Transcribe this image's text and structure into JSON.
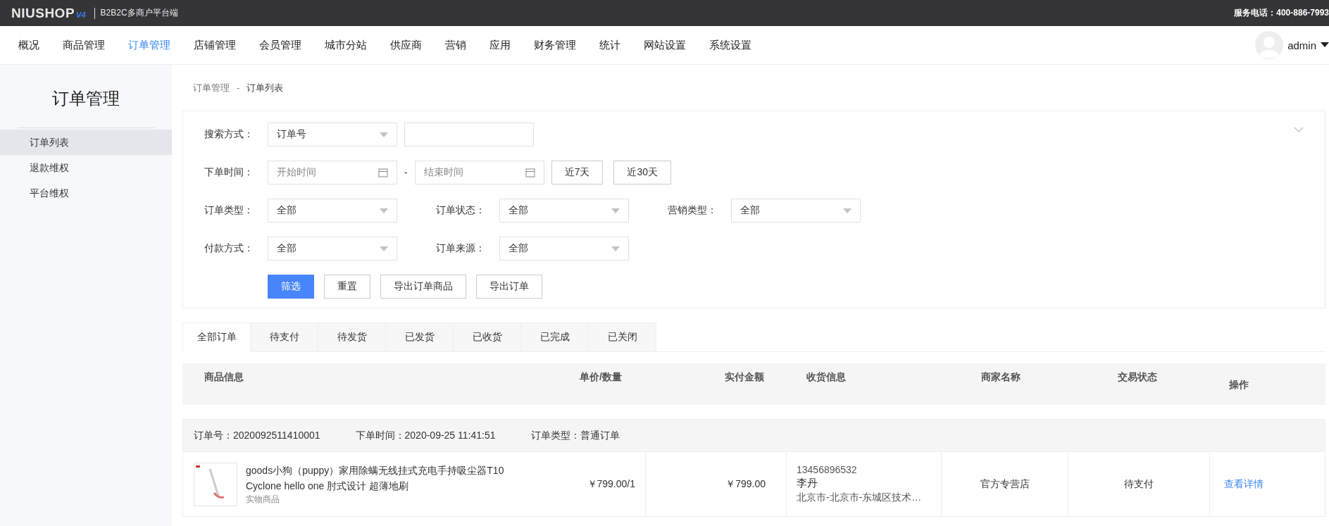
{
  "top_bar": {
    "logo": "NIUSHOP",
    "logo_version": "V4",
    "platform": "B2B2C多商户平台端",
    "hotline": "服务电话：400-886-7993"
  },
  "nav": {
    "items": [
      {
        "label": "概况",
        "selected": false
      },
      {
        "label": "商品管理",
        "selected": false
      },
      {
        "label": "订单管理",
        "selected": true
      },
      {
        "label": "店铺管理",
        "selected": false
      },
      {
        "label": "会员管理",
        "selected": false
      },
      {
        "label": "城市分站",
        "selected": false
      },
      {
        "label": "供应商",
        "selected": false
      },
      {
        "label": "营销",
        "selected": false
      },
      {
        "label": "应用",
        "selected": false
      },
      {
        "label": "财务管理",
        "selected": false
      },
      {
        "label": "统计",
        "selected": false
      },
      {
        "label": "网站设置",
        "selected": false
      },
      {
        "label": "系统设置",
        "selected": false
      }
    ],
    "user": "admin"
  },
  "sidebar": {
    "title": "订单管理",
    "items": [
      {
        "label": "订单列表",
        "selected": true
      },
      {
        "label": "退款维权",
        "selected": false
      },
      {
        "label": "平台维权",
        "selected": false
      }
    ]
  },
  "breadcrumb": [
    "订单管理",
    "-",
    "订单列表"
  ],
  "filters": {
    "search_label": "搜索方式：",
    "search_type": "订单号",
    "time_label": "下单时间：",
    "start_placeholder": "开始时间",
    "separator": "-",
    "end_placeholder": "结束时间",
    "quick_ranges": [
      "近7天",
      "近30天"
    ],
    "selects": [
      [
        {
          "label": "订单类型：",
          "value": "全部"
        },
        {
          "label": "订单状态：",
          "value": "全部"
        },
        {
          "label": "营销类型：",
          "value": "全部"
        }
      ],
      [
        {
          "label": "付款方式：",
          "value": "全部"
        },
        {
          "label": "订单来源：",
          "value": "全部"
        }
      ]
    ],
    "buttons": [
      {
        "label": "筛选",
        "kind": "primary"
      },
      {
        "label": "重置",
        "kind": "default"
      },
      {
        "label": "导出订单商品",
        "kind": "default"
      },
      {
        "label": "导出订单",
        "kind": "default"
      }
    ]
  },
  "tabs": [
    {
      "label": "全部订单",
      "selected": true
    },
    {
      "label": "待支付",
      "selected": false
    },
    {
      "label": "待发货",
      "selected": false
    },
    {
      "label": "已发货",
      "selected": false
    },
    {
      "label": "已收货",
      "selected": false
    },
    {
      "label": "已完成",
      "selected": false
    },
    {
      "label": "已关闭",
      "selected": false
    }
  ],
  "table": {
    "columns": [
      "商品信息",
      "单价/数量",
      "实付金额",
      "收货信息",
      "商家名称",
      "交易状态",
      "操作"
    ],
    "orders": [
      {
        "order_no": "订单号：2020092511410001",
        "order_time": "下单时间：2020-09-25 11:41:51",
        "order_type": "订单类型：普通订单",
        "goods_name": "goods小狗（puppy）家用除螨无线挂式充电手持吸尘器T10 Cyclone hello one 肘式设计 超薄地刷",
        "goods_kind": "实物商品",
        "price_qty": "￥799.00/1",
        "paid": "￥799.00",
        "phone": "13456896532",
        "receiver": "李丹",
        "address": "北京市-北京市-东城区技术…",
        "store": "官方专营店",
        "status": "待支付",
        "action": "查看详情"
      }
    ]
  }
}
